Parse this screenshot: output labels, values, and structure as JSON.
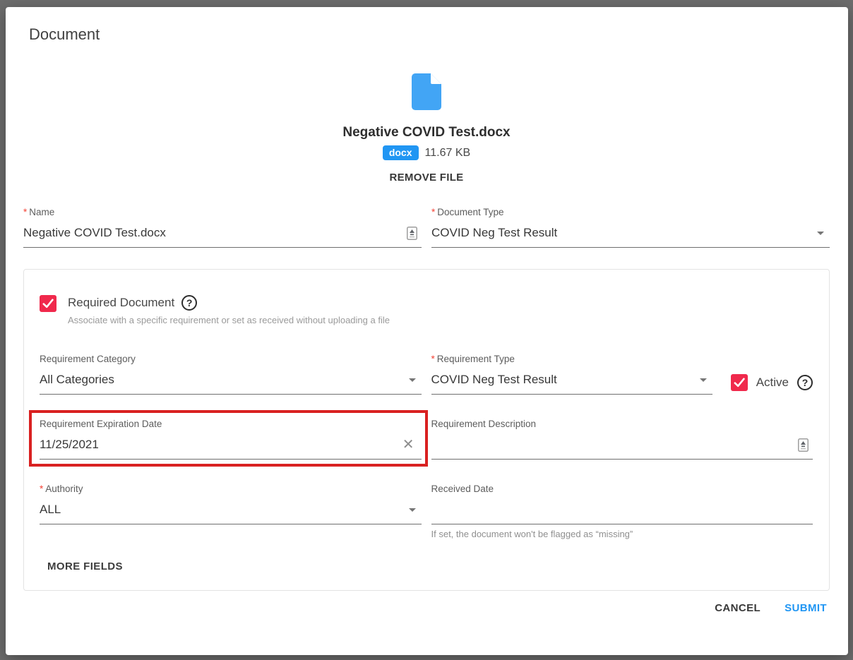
{
  "modal": {
    "title": "Document"
  },
  "file": {
    "name": "Negative COVID Test.docx",
    "ext": "docx",
    "size": "11.67 KB",
    "remove_label": "REMOVE FILE"
  },
  "form": {
    "required_marker": "*",
    "name": {
      "label": "Name",
      "value": "Negative COVID Test.docx"
    },
    "document_type": {
      "label": "Document Type",
      "value": "COVID Neg Test Result"
    },
    "required_document": {
      "label": "Required Document",
      "checked": true,
      "hint": "Associate with a specific requirement or set as received without uploading a file"
    },
    "requirement_category": {
      "label": "Requirement Category",
      "value": "All Categories"
    },
    "requirement_type": {
      "label": "Requirement Type",
      "value": "COVID Neg Test Result"
    },
    "active": {
      "label": "Active",
      "checked": true
    },
    "requirement_expiration_date": {
      "label": "Requirement Expiration Date",
      "value": "11/25/2021"
    },
    "requirement_description": {
      "label": "Requirement Description",
      "value": ""
    },
    "authority": {
      "label": "Authority",
      "value": "ALL"
    },
    "received_date": {
      "label": "Received Date",
      "value": "",
      "helper": "If set, the document won't be flagged as “missing”"
    },
    "more_fields_label": "MORE FIELDS"
  },
  "footer": {
    "cancel_label": "CANCEL",
    "submit_label": "SUBMIT"
  },
  "icons": {
    "help": "?",
    "clear": "✕"
  },
  "colors": {
    "accent_blue": "#2196f3",
    "badge_blue": "#2196f3",
    "file_icon_blue": "#42a5f5",
    "checkbox_red": "#f0294c",
    "annotation_red": "#d92121"
  }
}
